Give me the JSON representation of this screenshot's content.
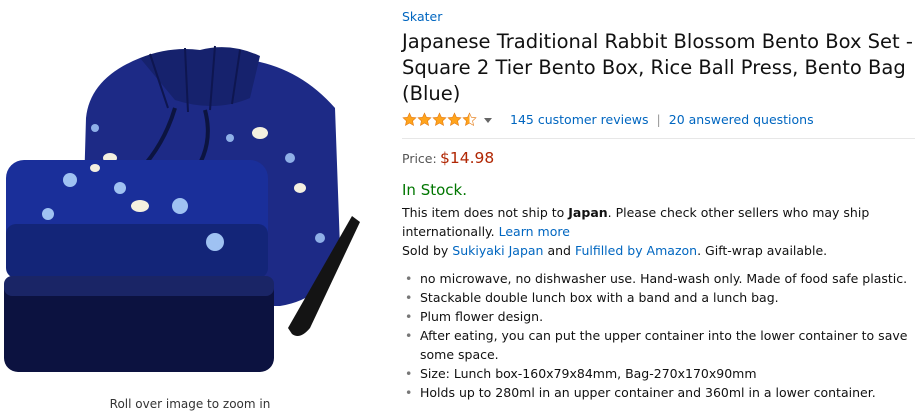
{
  "product": {
    "brand": "Skater",
    "title": "Japanese Traditional Rabbit Blossom Bento Box Set - Square 2 Tier Bento Box, Rice Ball Press, Bento Bag (Blue)",
    "rating_value": 4.5,
    "reviews_link": "145 customer reviews",
    "questions_link": "20 answered questions",
    "price_label": "Price:",
    "price": "$14.98",
    "stock": "In Stock.",
    "ship_text_1": "This item does not ship to ",
    "ship_country": "Japan",
    "ship_text_2": ". Please check other sellers who may ship internationally. ",
    "learn_more": "Learn more",
    "sold_by_prefix": "Sold by ",
    "seller": "Sukiyaki Japan",
    "sold_by_middle": " and ",
    "fulfilled": "Fulfilled by Amazon",
    "sold_by_suffix": ". Gift-wrap available.",
    "bullets": [
      "no microwave, no dishwasher use. Hand-wash only. Made of food safe plastic.",
      "Stackable double lunch box with a band and a lunch bag.",
      "Plum flower design.",
      "After eating, you can put the upper container into the lower container to save some space.",
      "Size: Lunch box-160x79x84mm, Bag-270x170x90mm",
      "Holds up to 280ml in an upper container and 360ml in a lower container."
    ]
  },
  "image": {
    "zoom_hint": "Roll over image to zoom in"
  },
  "colors": {
    "link": "#0066c0",
    "price": "#b12704",
    "in_stock": "#007600",
    "star": "#ffa41c",
    "bento_blue": "#1b2a7a"
  }
}
